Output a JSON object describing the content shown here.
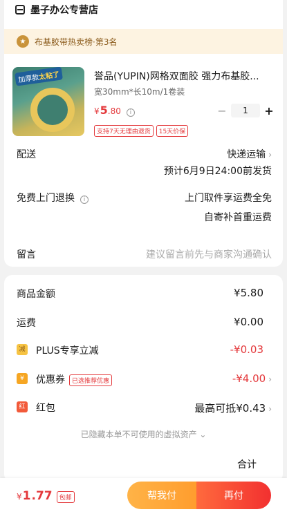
{
  "shop": {
    "name": "墨子办公专营店",
    "icon": "store-icon"
  },
  "rank": {
    "text": "布基胶带热卖榜·第3名",
    "icon": "medal-icon"
  },
  "product": {
    "thumb_tag_a": "加厚款",
    "thumb_tag_b": "太粘了",
    "title": "誉品(YUPIN)网格双面胶 强力布基胶...",
    "spec": "宽30mm*长10m/1卷装",
    "price_symbol": "¥",
    "price_int": "5",
    "price_dec": ".80",
    "quantity": "1",
    "minus": "−",
    "plus": "+",
    "badges": [
      "支持7天无理由退货",
      "15天价保"
    ]
  },
  "delivery": {
    "label": "配送",
    "method": "快递运输",
    "eta": "预计6月9日24:00前发货"
  },
  "return": {
    "label": "免费上门退换",
    "line1": "上门取件享运费全免",
    "line2": "自寄补首重运费"
  },
  "message": {
    "label": "留言",
    "placeholder": "建议留言前先与商家沟通确认"
  },
  "summary": {
    "goods_label": "商品金额",
    "goods_amount": "¥5.80",
    "freight_label": "运费",
    "freight_amount": "¥0.00",
    "plus_label": "PLUS专享立减",
    "plus_amount": "-¥0.03",
    "coupon_label": "优惠券",
    "coupon_chip": "已选推荐优惠",
    "coupon_amount": "-¥4.00",
    "redpacket_label": "红包",
    "redpacket_amount": "最高可抵¥0.43",
    "hidden_note": "已隐藏本单不可使用的虚拟资产 ⌄",
    "partial_total": "合计"
  },
  "bottom": {
    "yen": "¥",
    "total_int": "1",
    "total_dec": ".77",
    "free_ship_chip": "包邮",
    "help_pay": "帮我付",
    "pay": "再付"
  },
  "colors": {
    "accent": "#e4393c",
    "help_btn": "#ffa83a",
    "rank_bg": "#fdf3e1"
  }
}
